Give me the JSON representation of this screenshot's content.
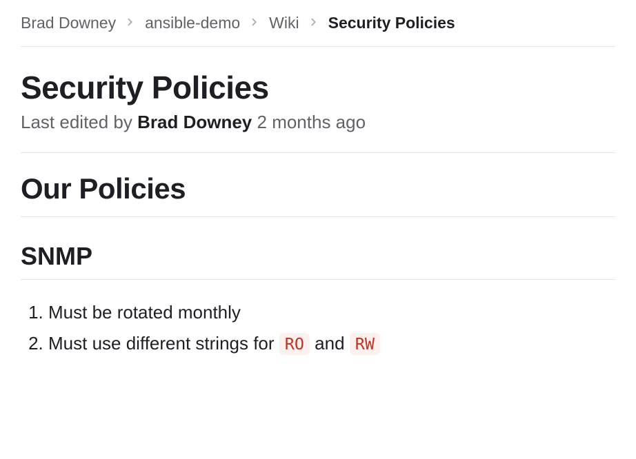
{
  "breadcrumb": {
    "items": [
      {
        "label": "Brad Downey"
      },
      {
        "label": "ansible-demo"
      },
      {
        "label": "Wiki"
      }
    ],
    "current": "Security Policies"
  },
  "header": {
    "title": "Security Policies",
    "meta_prefix": "Last edited by ",
    "author": "Brad Downey",
    "meta_time": " 2 months ago"
  },
  "content": {
    "h1": "Our Policies",
    "h2": "SNMP",
    "list": {
      "item1": "Must be rotated monthly",
      "item2_prefix": "Must use different strings for ",
      "item2_code1": "RO",
      "item2_mid": " and ",
      "item2_code2": "RW"
    }
  }
}
